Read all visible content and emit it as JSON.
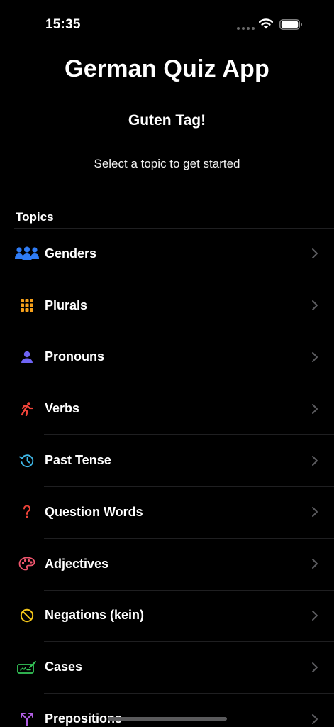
{
  "status_bar": {
    "time": "15:35"
  },
  "header": {
    "title": "German Quiz App",
    "greeting": "Guten Tag!",
    "subtitle": "Select a topic to get started"
  },
  "topics": {
    "section_title": "Topics",
    "items": [
      {
        "label": "Genders",
        "icon": "people-icon",
        "color": "#2f7cf6"
      },
      {
        "label": "Plurals",
        "icon": "grid-icon",
        "color": "#f6a01a"
      },
      {
        "label": "Pronouns",
        "icon": "person-icon",
        "color": "#6f64f5"
      },
      {
        "label": "Verbs",
        "icon": "running-figure-icon",
        "color": "#f0443a"
      },
      {
        "label": "Past Tense",
        "icon": "history-clock-icon",
        "color": "#3fb8e8"
      },
      {
        "label": "Question Words",
        "icon": "question-mark-icon",
        "color": "#f0443a"
      },
      {
        "label": "Adjectives",
        "icon": "paint-palette-icon",
        "color": "#f0566e"
      },
      {
        "label": "Negations (kein)",
        "icon": "prohibited-icon",
        "color": "#f5c71a"
      },
      {
        "label": "Cases",
        "icon": "signature-icon",
        "color": "#35c759"
      },
      {
        "label": "Prepositions",
        "icon": "arrows-split-icon",
        "color": "#b15ee3"
      }
    ]
  }
}
